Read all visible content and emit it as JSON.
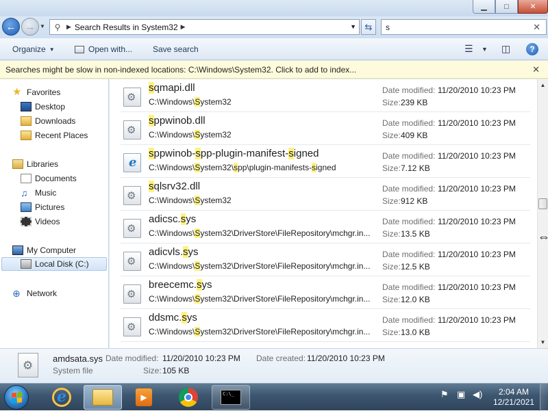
{
  "window": {
    "caption_buttons": {
      "minimize": "▁",
      "maximize": "□",
      "close": "✕"
    },
    "address": {
      "path": "Search Results in System32"
    },
    "search_value": "s"
  },
  "toolbar": {
    "organize": "Organize",
    "open_with": "Open with...",
    "save_search": "Save search",
    "help": "?"
  },
  "infobar": {
    "message": "Searches might be slow in non-indexed locations: C:\\Windows\\System32. Click to add to index..."
  },
  "nav": {
    "favorites": "Favorites",
    "desktop": "Desktop",
    "downloads": "Downloads",
    "recent_places": "Recent Places",
    "libraries": "Libraries",
    "documents": "Documents",
    "music": "Music",
    "pictures": "Pictures",
    "videos": "Videos",
    "my_computer": "My Computer",
    "local_disk": "Local Disk (C:)",
    "network": "Network"
  },
  "labels": {
    "date_modified": "Date modified:",
    "size": "Size:",
    "date_created": "Date created:",
    "size_detail": "Size:"
  },
  "results": [
    {
      "icon": "dll-gear-icon",
      "name_hl": "s",
      "name_rest": "qmapi.dll",
      "path_pre": "C:\\Windows\\",
      "path_hl": "S",
      "path_rest": "ystem32",
      "date": "11/20/2010 10:23 PM",
      "size": "239 KB"
    },
    {
      "icon": "dll-gear-icon",
      "name_hl": "s",
      "name_rest": "ppwinob.dll",
      "path_pre": "C:\\Windows\\",
      "path_hl": "S",
      "path_rest": "ystem32",
      "date": "11/20/2010 10:23 PM",
      "size": "409 KB"
    },
    {
      "icon": "ie-icon",
      "name_html": "<mark>s</mark>ppwinob-<mark>s</mark>pp-plugin-manifest-<mark>s</mark>igned",
      "path_html": "C:\\Windows\\<mark>S</mark>ystem32\\<mark>s</mark>pp\\plugin-manifests-<mark>s</mark>igned",
      "date": "11/20/2010 10:23 PM",
      "size": "7.12 KB"
    },
    {
      "icon": "dll-gear-icon",
      "name_hl": "s",
      "name_rest": "qlsrv32.dll",
      "path_pre": "C:\\Windows\\",
      "path_hl": "S",
      "path_rest": "ystem32",
      "date": "11/20/2010 10:23 PM",
      "size": "912 KB"
    },
    {
      "icon": "sys-gear-icon",
      "name_html": "adicsc.<mark>s</mark>ys",
      "path_html": "C:\\Windows\\<mark>S</mark>ystem32\\DriverStore\\FileRepository\\mchgr.in...",
      "date": "11/20/2010 10:23 PM",
      "size": "13.5 KB"
    },
    {
      "icon": "sys-gear-icon",
      "name_html": "adicvls.<mark>s</mark>ys",
      "path_html": "C:\\Windows\\<mark>S</mark>ystem32\\DriverStore\\FileRepository\\mchgr.in...",
      "date": "11/20/2010 10:23 PM",
      "size": "12.5 KB"
    },
    {
      "icon": "sys-gear-icon",
      "name_html": "breecemc.<mark>s</mark>ys",
      "path_html": "C:\\Windows\\<mark>S</mark>ystem32\\DriverStore\\FileRepository\\mchgr.in...",
      "date": "11/20/2010 10:23 PM",
      "size": "12.0 KB"
    },
    {
      "icon": "sys-gear-icon",
      "name_html": "ddsmc.<mark>s</mark>ys",
      "path_html": "C:\\Windows\\<mark>S</mark>ystem32\\DriverStore\\FileRepository\\mchgr.in...",
      "date": "11/20/2010 10:23 PM",
      "size": "13.0 KB"
    }
  ],
  "details": {
    "name": "amdsata.sys",
    "type": "System file",
    "date_modified": "11/20/2010 10:23 PM",
    "date_created": "11/20/2010 10:23 PM",
    "size": "105 KB"
  },
  "taskbar": {
    "time": "2:04 AM",
    "date": "12/21/2021",
    "cmd_text": "C:\\_"
  },
  "colors": {
    "highlight": "#fff17e",
    "accent": "#1f5fb8",
    "infobar_bg": "#fefbdc"
  }
}
